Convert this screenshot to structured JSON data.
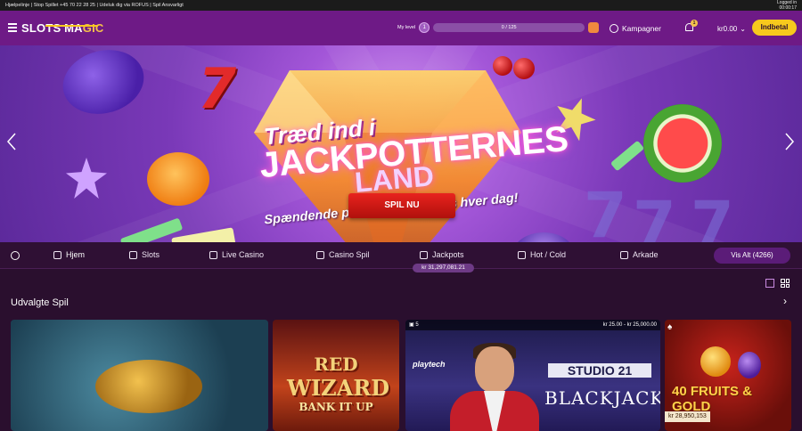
{
  "infobar": {
    "text": "Hjælpelinje | Stop Spillet +45 70 22 28 25 | Udeluk dig via ROFUS | Spil Ansvarligt",
    "logged_in_label": "Logged in",
    "timer": "00:00:17"
  },
  "header": {
    "logo_text_1": "SLOTS MA",
    "logo_text_2": "GIC",
    "level_label": "My level",
    "level_number": "1",
    "level_progress_text": "0 / 125",
    "level_progress_fraction": 0.0,
    "campaigns_label": "Kampagner",
    "notifications_count": "1",
    "balance": "kr0.00",
    "deposit_label": "Indbetal"
  },
  "hero": {
    "title_line1": "Træd ind i",
    "title_line2": "JACKPOTTERNES",
    "title_line3": "LAND",
    "subtitle": "Spændende præmier udbetales hver dag!",
    "cta_label": "SPIL NU"
  },
  "nav": {
    "items": [
      {
        "label": "Hjem",
        "icon": "home-icon"
      },
      {
        "label": "Slots",
        "icon": "slot-machine-icon"
      },
      {
        "label": "Live Casino",
        "icon": "dealer-icon"
      },
      {
        "label": "Casino Spil",
        "icon": "cards-icon"
      },
      {
        "label": "Jackpots",
        "icon": "jackpot-icon"
      },
      {
        "label": "Hot / Cold",
        "icon": "snowflake-icon"
      },
      {
        "label": "Arkade",
        "icon": "arcade-icon"
      }
    ],
    "jackpot_total": "kr 31,297,081.21",
    "view_all_label": "Vis Alt (4266)"
  },
  "section": {
    "title": "Udvalgte Spil"
  },
  "games": [
    {
      "name": "fishing game"
    },
    {
      "title_1": "RED",
      "title_2": "WIZARD",
      "title_3": "BANK IT UP"
    },
    {
      "seats": "5",
      "limits": "kr 25.00 - kr 25,000.00",
      "provider": "playtech",
      "studio": "STUDIO 21",
      "game": "BLACKJACK"
    },
    {
      "title": "40 FRUITS & GOLD",
      "jackpot": "kr 28,950,153"
    }
  ],
  "colors": {
    "header_bg": "#6e1a86",
    "accent_yellow": "#f7c91d",
    "page_bg": "#2a0f2e",
    "cta_red": "#e8231e"
  }
}
